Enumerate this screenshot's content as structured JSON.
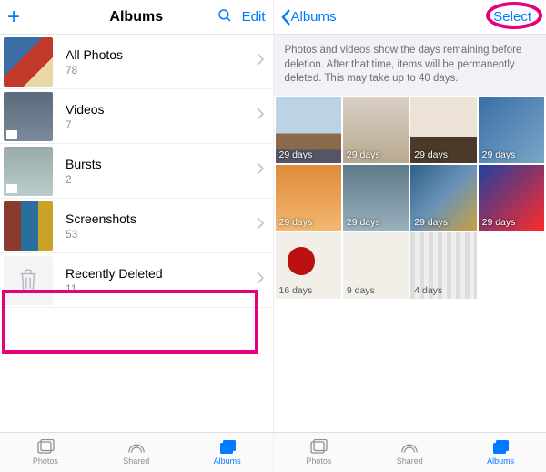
{
  "left": {
    "nav": {
      "title": "Albums",
      "edit": "Edit"
    },
    "albums": [
      {
        "title": "All Photos",
        "count": "78"
      },
      {
        "title": "Videos",
        "count": "7"
      },
      {
        "title": "Bursts",
        "count": "2"
      },
      {
        "title": "Screenshots",
        "count": "53"
      },
      {
        "title": "Recently Deleted",
        "count": "11"
      }
    ]
  },
  "right": {
    "nav": {
      "back": "Albums",
      "select": "Select"
    },
    "info": "Photos and videos show the days remaining before deletion. After that time, items will be permanently deleted. This may take up to 40 days.",
    "cells": [
      {
        "days": "29 days"
      },
      {
        "days": "29 days"
      },
      {
        "days": "29 days"
      },
      {
        "days": "29 days"
      },
      {
        "days": "29 days"
      },
      {
        "days": "29 days"
      },
      {
        "days": "29 days"
      },
      {
        "days": "29 days"
      },
      {
        "days": "16 days"
      },
      {
        "days": "9 days"
      },
      {
        "days": "4 days"
      }
    ]
  },
  "tabs": {
    "photos": "Photos",
    "shared": "Shared",
    "albums": "Albums"
  }
}
